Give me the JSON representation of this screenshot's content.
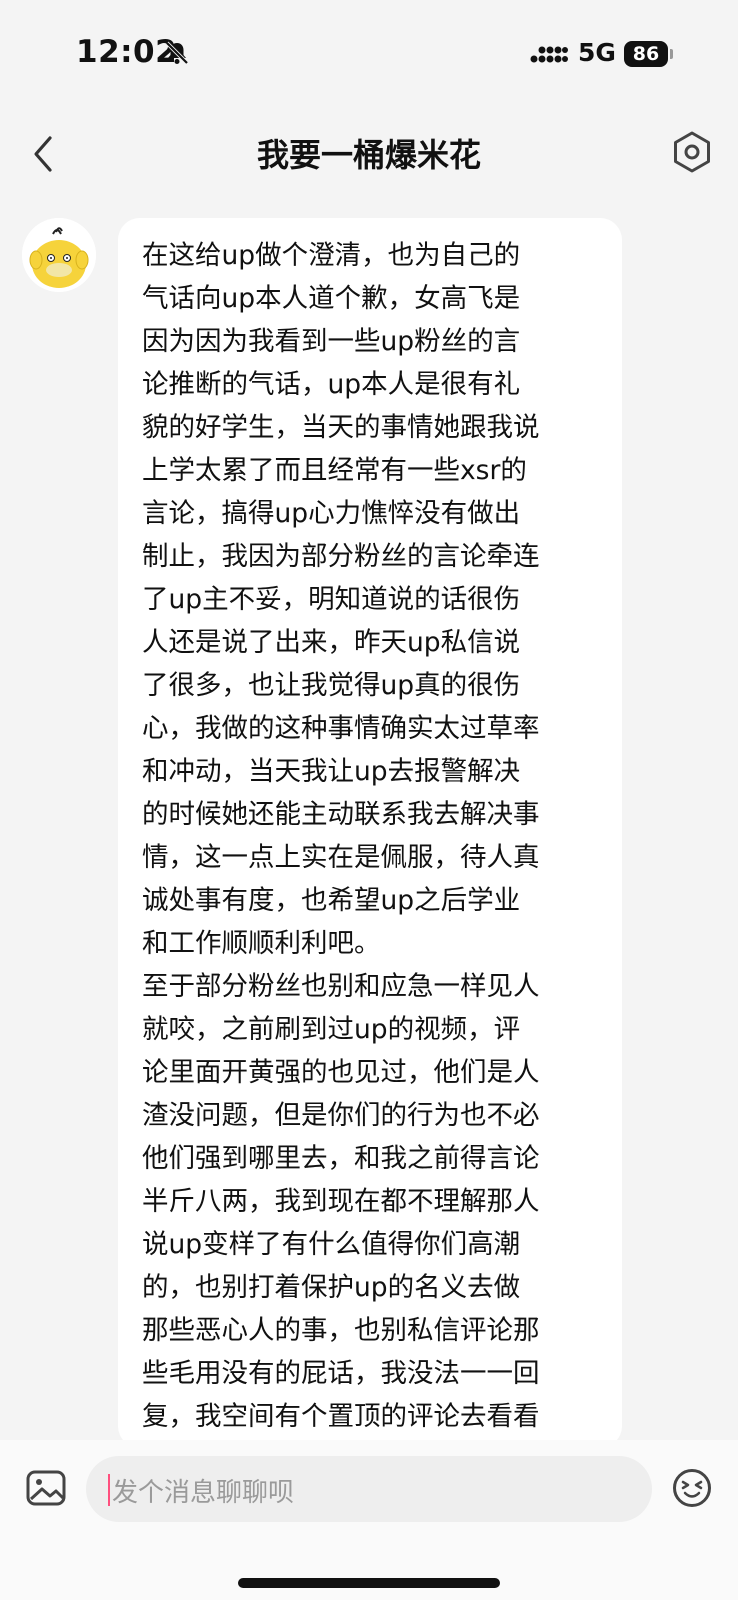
{
  "status_bar": {
    "time": "12:02",
    "network": "5G",
    "battery": "86"
  },
  "header": {
    "title": "我要一桶爆米花",
    "icons": {
      "back": "chevron-left-icon",
      "settings": "hexagon-settings-icon"
    }
  },
  "message": {
    "sender_avatar": "yellow-duck-avatar",
    "text": "在这给up做个澄清，也为自己的\n气话向up本人道个歉，女高飞是\n因为因为我看到一些up粉丝的言\n论推断的气话，up本人是很有礼\n貌的好学生，当天的事情她跟我说\n上学太累了而且经常有一些xsr的\n言论，搞得up心力憔悴没有做出\n制止，我因为部分粉丝的言论牵连\n了up主不妥，明知道说的话很伤\n人还是说了出来，昨天up私信说\n了很多，也让我觉得up真的很伤\n心，我做的这种事情确实太过草率\n和冲动，当天我让up去报警解决\n的时候她还能主动联系我去解决事\n情，这一点上实在是佩服，待人真\n诚处事有度，也希望up之后学业\n和工作顺顺利利吧。\n至于部分粉丝也别和应急一样见人\n就咬，之前刷到过up的视频，评\n论里面开黄强的也见过，他们是人\n渣没问题，但是你们的行为也不必\n他们强到哪里去，和我之前得言论\n半斤八两，我到现在都不理解那人\n说up变样了有什么值得你们高潮\n的，也别打着保护up的名义去做\n那些恶心人的事，也别私信评论那\n些毛用没有的屁话，我没法一一回\n复，我空间有个置顶的评论去看看\n就知道了，到时候我欢迎。"
  },
  "input_bar": {
    "placeholder": "发个消息聊聊呗",
    "icons": {
      "image": "image-icon",
      "emoji": "emoji-icon"
    }
  },
  "colors": {
    "background": "#f4f4f4",
    "bubble": "#ffffff",
    "caret": "#ff4f7e"
  }
}
